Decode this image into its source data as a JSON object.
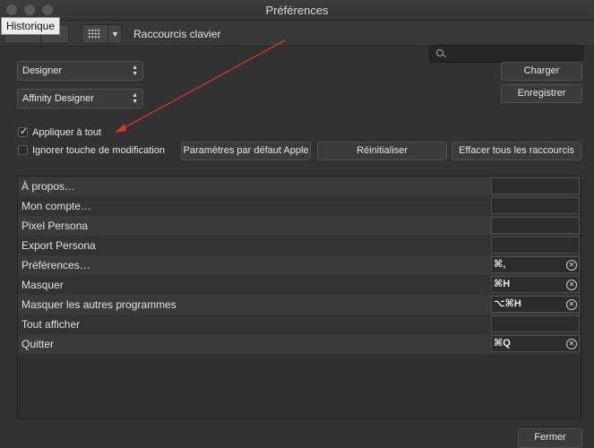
{
  "window": {
    "title": "Préférences",
    "tooltip": "Historique"
  },
  "toolbar": {
    "section_label": "Raccourcis clavier",
    "search_value": ""
  },
  "selects": {
    "app": "Designer",
    "preset": "Affinity Designer"
  },
  "buttons": {
    "load": "Charger",
    "save": "Enregistrer",
    "apple_defaults": "Paramètres par défaut Apple",
    "reset": "Réinitialiser",
    "clear_all": "Effacer tous les raccourcis",
    "close": "Fermer"
  },
  "options": {
    "apply_all": {
      "label": "Appliquer à tout",
      "checked": true
    },
    "ignore_modifier": {
      "label": "Ignorer touche de modification",
      "checked": false
    }
  },
  "shortcuts": [
    {
      "name": "À propos…",
      "key": ""
    },
    {
      "name": "Mon compte…",
      "key": ""
    },
    {
      "name": "Pixel Persona",
      "key": ""
    },
    {
      "name": "Export Persona",
      "key": ""
    },
    {
      "name": "Préférences…",
      "key": "⌘,"
    },
    {
      "name": "Masquer",
      "key": "⌘H"
    },
    {
      "name": "Masquer les autres programmes",
      "key": "⌥⌘H"
    },
    {
      "name": "Tout afficher",
      "key": ""
    },
    {
      "name": "Quitter",
      "key": "⌘Q"
    }
  ],
  "colors": {
    "background": "#323232",
    "annotation_arrow": "#d9342b"
  }
}
